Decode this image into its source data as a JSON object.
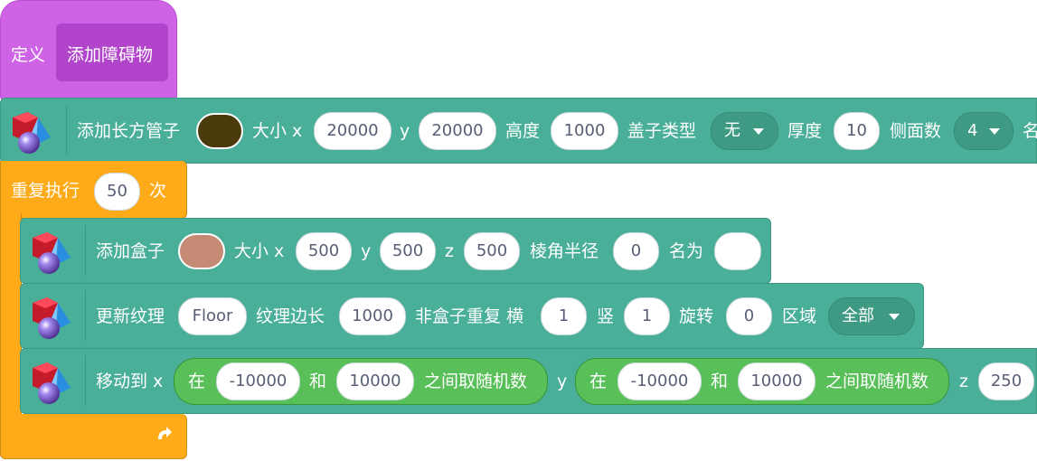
{
  "define": {
    "label": "定义",
    "name": "添加障碍物"
  },
  "tube": {
    "label": "添加长方管子",
    "size_label": "大小 x",
    "x": "20000",
    "y_label": "y",
    "y": "20000",
    "height_label": "高度",
    "height": "1000",
    "cap_label": "盖子类型",
    "cap": "无",
    "thickness_label": "厚度",
    "thickness": "10",
    "sides_label": "侧面数",
    "sides": "4",
    "name_label": "名",
    "color": "#4a3a0c"
  },
  "repeat": {
    "label": "重复执行",
    "count": "50",
    "suffix": "次"
  },
  "box": {
    "label": "添加盒子",
    "size_label": "大小 x",
    "x": "500",
    "y_label": "y",
    "y": "500",
    "z_label": "z",
    "z": "500",
    "radius_label": "棱角半径",
    "radius": "0",
    "name_label": "名为",
    "name": "",
    "color": "#c48a74"
  },
  "texture": {
    "label": "更新纹理",
    "texture": "Floor",
    "edge_label": "纹理边长",
    "edge": "1000",
    "nonbox_label": "非盒子重复 横",
    "h": "1",
    "v_label": "竖",
    "v": "1",
    "rot_label": "旋转",
    "rot": "0",
    "area_label": "区域",
    "area": "全部"
  },
  "move": {
    "label": "移动到 x",
    "r1": {
      "between": "在",
      "from": "-10000",
      "and": "和",
      "to": "10000",
      "suffix": "之间取随机数"
    },
    "y_label": "y",
    "r2": {
      "between": "在",
      "from": "-10000",
      "and": "和",
      "to": "10000",
      "suffix": "之间取随机数"
    },
    "z_label": "z",
    "z": "250"
  },
  "icons": {
    "extension": "3d-shapes-icon",
    "repeat_arrow": "loop-arrow-icon"
  },
  "colors": {
    "define": "#cf63e6",
    "extension": "#49af98",
    "control": "#ffab19",
    "operator": "#59c059"
  }
}
